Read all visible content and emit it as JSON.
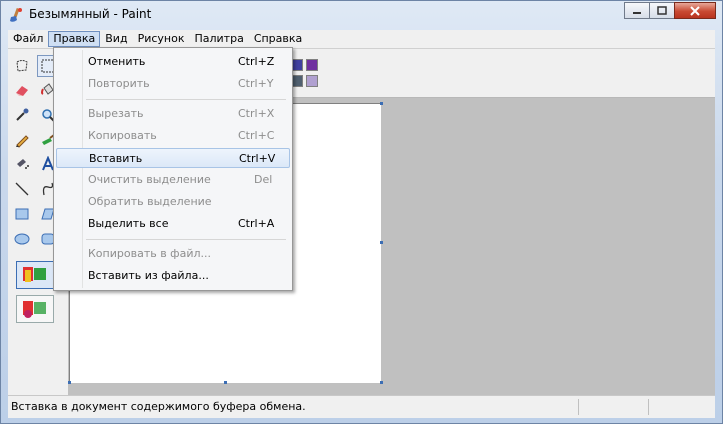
{
  "window": {
    "title": "Безымянный - Paint"
  },
  "menubar": {
    "items": [
      {
        "label": "Файл"
      },
      {
        "label": "Правка"
      },
      {
        "label": "Вид"
      },
      {
        "label": "Рисунок"
      },
      {
        "label": "Палитра"
      },
      {
        "label": "Справка"
      }
    ]
  },
  "edit_menu": {
    "items": [
      {
        "label": "Отменить",
        "shortcut": "Ctrl+Z",
        "enabled": true
      },
      {
        "label": "Повторить",
        "shortcut": "Ctrl+Y",
        "enabled": false
      },
      {
        "label": "Вырезать",
        "shortcut": "Ctrl+X",
        "enabled": false
      },
      {
        "label": "Копировать",
        "shortcut": "Ctrl+C",
        "enabled": false
      },
      {
        "label": "Вставить",
        "shortcut": "Ctrl+V",
        "enabled": true,
        "highlighted": true
      },
      {
        "label": "Очистить выделение",
        "shortcut": "Del",
        "enabled": false
      },
      {
        "label": "Обратить выделение",
        "shortcut": "",
        "enabled": false
      },
      {
        "label": "Выделить все",
        "shortcut": "Ctrl+A",
        "enabled": true
      },
      {
        "label": "Копировать в файл...",
        "shortcut": "",
        "enabled": false
      },
      {
        "label": "Вставить из файла...",
        "shortcut": "",
        "enabled": true
      }
    ]
  },
  "statusbar": {
    "text": "Вставка в документ содержимого буфера обмена."
  },
  "palette": {
    "visible_colors": [
      "#4040a0",
      "#7030a0",
      "#506070",
      "#b0a0d0"
    ]
  },
  "colors": {
    "menu_active": "#cfdff3",
    "workspace": "#c0c0c0",
    "selection_handle": "#3c6eb4"
  }
}
